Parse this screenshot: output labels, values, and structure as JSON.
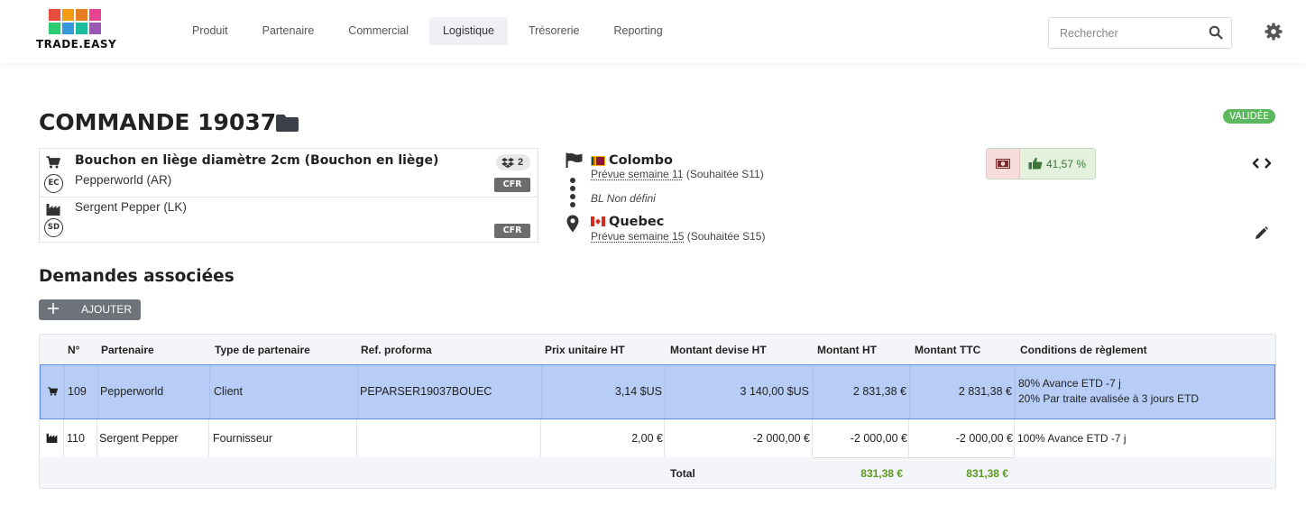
{
  "app": {
    "logo_text": "TRADE.EASY",
    "logo_colors": [
      "#e74c3c",
      "#f39c12",
      "#e67e22",
      "#e84393",
      "#2ecc71",
      "#3498db",
      "#1abc9c",
      "#9b59b6"
    ]
  },
  "nav": {
    "items": [
      {
        "label": "Produit"
      },
      {
        "label": "Partenaire"
      },
      {
        "label": "Commercial"
      },
      {
        "label": "Logistique",
        "active": true
      },
      {
        "label": "Trésorerie"
      },
      {
        "label": "Reporting"
      }
    ]
  },
  "search": {
    "placeholder": "Rechercher",
    "icon": "search-icon"
  },
  "order": {
    "title": "COMMANDE 19037",
    "status": "VALIDÉE",
    "status_color": "#5cb85c"
  },
  "product": {
    "name": "Bouchon en liège diamètre 2cm (Bouchon en liège)",
    "dropbox_count": "2",
    "client_code": "EC",
    "client": "Pepperworld (AR)",
    "client_incoterm": "CFR",
    "supplier_code": "SD",
    "supplier": "Sergent Pepper (LK)",
    "supplier_incoterm": "CFR"
  },
  "route": {
    "origin_city": "Colombo",
    "origin_planned": "Prévue semaine 11",
    "origin_wished": " (Souhaitée S11)",
    "bl": "BL Non défini",
    "destination_city": "Quebec",
    "destination_planned": "Prévue semaine 15",
    "destination_wished": " (Souhaitée S15)"
  },
  "margin": {
    "value": "41,57 %",
    "positive_color": "#3c763d"
  },
  "section": {
    "title": "Demandes associées",
    "add_label": "AJOUTER"
  },
  "table": {
    "headers": {
      "num": "N°",
      "partner": "Partenaire",
      "type": "Type de partenaire",
      "ref": "Ref. proforma",
      "unit_price": "Prix unitaire HT",
      "amount_currency": "Montant devise HT",
      "amount_ht": "Montant HT",
      "amount_ttc": "Montant TTC",
      "conditions": "Conditions de règlement"
    },
    "rows": [
      {
        "icon": "cart-icon",
        "num": "109",
        "partner": "Pepperworld",
        "type": "Client",
        "ref": "PEPARSER19037BOUEC",
        "unit_price": "3,14 $US",
        "amount_currency": "3 140,00 $US",
        "amount_ht": "2 831,38 €",
        "amount_ttc": "2 831,38 €",
        "conditions_1": "80% Avance ETD -7 j",
        "conditions_2": "20% Par traite avalisée à 3 jours ETD"
      },
      {
        "icon": "factory-icon",
        "num": "110",
        "partner": "Sergent Pepper",
        "type": "Fournisseur",
        "ref": "",
        "unit_price": "2,00 €",
        "amount_currency": "-2 000,00 €",
        "amount_ht": "-2 000,00 €",
        "amount_ttc": "-2 000,00 €",
        "conditions_1": "100% Avance ETD -7 j"
      }
    ],
    "total": {
      "label": "Total",
      "amount_ht": "831,38 €",
      "amount_ttc": "831,38 €"
    }
  }
}
